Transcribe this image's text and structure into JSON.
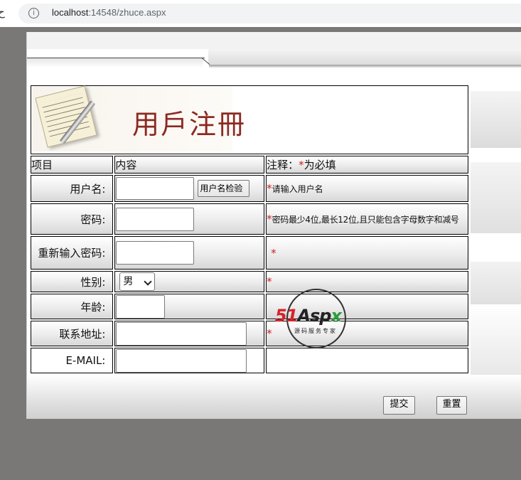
{
  "browser": {
    "back_glyph": "ح",
    "info_icon": "i",
    "url_host": "localhost",
    "url_rest": ":14548/zhuce.aspx"
  },
  "banner": {
    "title": "用戶注冊"
  },
  "table": {
    "headers": [
      "项目",
      "内容",
      "注释："
    ],
    "header_required_star": "*",
    "header_required_text": "为必填"
  },
  "fields": {
    "username": {
      "label": "用户名:",
      "check_button": "用户名检验",
      "note_star": "*",
      "note": "请输入用户名"
    },
    "password": {
      "label": "密码:",
      "note_star": "*",
      "note": "密码最少4位,最长12位,且只能包含字母数字和减号"
    },
    "password_confirm": {
      "label": "重新输入密码:",
      "note_star": "*"
    },
    "gender": {
      "label": "性别:",
      "selected": "男",
      "note_star": "*"
    },
    "age": {
      "label": "年龄:"
    },
    "address": {
      "label": "联系地址:",
      "note_star": "*"
    },
    "email": {
      "label": "E-MAIL:"
    }
  },
  "actions": {
    "submit": "提交",
    "reset": "重置"
  },
  "watermark": {
    "logo_51": "51",
    "logo_asp": "Asp",
    "logo_x": "x",
    "subtitle": "源码服务专家"
  },
  "colors": {
    "banner_title": "#8b2a22",
    "required_star": "#cc2222",
    "outer_background": "#7a7876"
  }
}
